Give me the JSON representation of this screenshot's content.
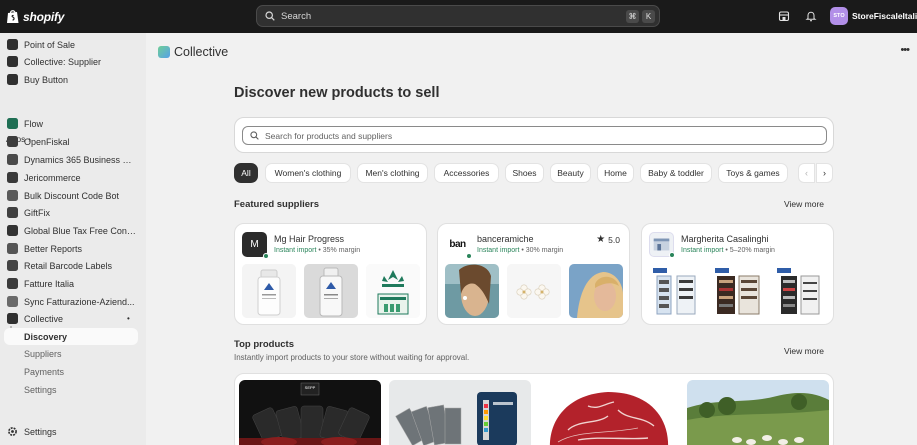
{
  "topbar": {
    "brand": "shopify",
    "search_placeholder": "Search",
    "shortcut_key1": "⌘",
    "shortcut_key2": "K",
    "store_initials": "STO",
    "store_name": "StoreFiscaleItalia"
  },
  "sidebar": {
    "top_items": [
      {
        "label": "Point of Sale"
      },
      {
        "label": "Collective: Supplier"
      },
      {
        "label": "Buy Button"
      }
    ],
    "apps_label": "Apps",
    "apps": [
      {
        "label": "Flow"
      },
      {
        "label": "OpenFiskal"
      },
      {
        "label": "Dynamics 365 Business C..."
      },
      {
        "label": "Jericommerce"
      },
      {
        "label": "Bulk Discount Code Bot"
      },
      {
        "label": "GiftFix"
      },
      {
        "label": "Global Blue Tax Free Conn..."
      },
      {
        "label": "Better Reports"
      },
      {
        "label": "Retail Barcode Labels"
      },
      {
        "label": "Fatture Italia"
      },
      {
        "label": "Sync Fatturazione-Aziend..."
      },
      {
        "label": "Collective"
      }
    ],
    "collective_sub": [
      {
        "label": "Discovery",
        "active": true
      },
      {
        "label": "Suppliers"
      },
      {
        "label": "Payments"
      },
      {
        "label": "Settings"
      }
    ],
    "settings_label": "Settings"
  },
  "main": {
    "app_title": "Collective",
    "more_label": "•••",
    "page_title": "Discover new products to sell",
    "search_placeholder": "Search for products and suppliers",
    "categories": [
      {
        "label": "All",
        "active": true
      },
      {
        "label": "Women's clothing"
      },
      {
        "label": "Men's clothing"
      },
      {
        "label": "Accessories"
      },
      {
        "label": "Shoes"
      },
      {
        "label": "Beauty"
      },
      {
        "label": "Home"
      },
      {
        "label": "Baby & toddler"
      },
      {
        "label": "Toys & games"
      }
    ],
    "featured_title": "Featured suppliers",
    "view_more": "View more",
    "suppliers": [
      {
        "name": "Mg Hair Progress",
        "instant": "Instant import",
        "margin": " • 35% margin",
        "logo_text": "M"
      },
      {
        "name": "banceramiche",
        "instant": "Instant import",
        "margin": " • 30% margin",
        "logo_text": "ban",
        "rating": "5.0"
      },
      {
        "name": "Margherita Casalinghi",
        "instant": "Instant import",
        "margin": " • 5–20% margin"
      }
    ],
    "top_title": "Top products",
    "top_subtitle": "Instantly import products to your store without waiting for approval.",
    "product_brand": "SEPP"
  }
}
